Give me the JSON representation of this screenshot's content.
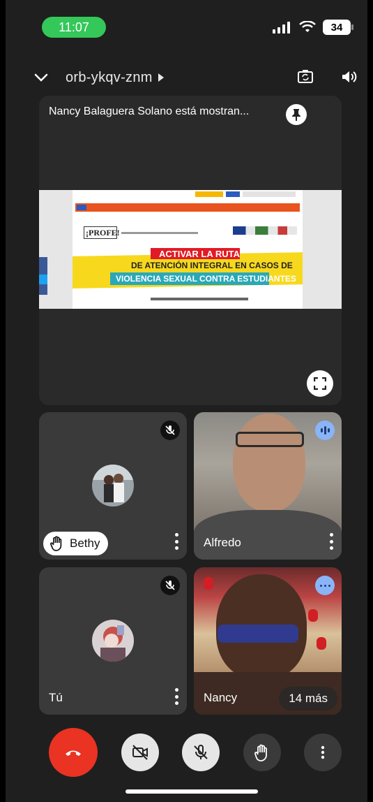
{
  "status_bar": {
    "time": "11:07",
    "battery": "34"
  },
  "meeting": {
    "code": "orb-ykqv-znm"
  },
  "presentation": {
    "title": "Nancy Balaguera Solano está mostran...",
    "shared_page": {
      "badge": "¡PROFE!",
      "banner_line1": "ACTIVAR LA RUTA",
      "banner_line2": "DE ATENCIÓN INTEGRAL EN CASOS DE",
      "banner_line3": "VIOLENCIA SEXUAL CONTRA ESTUDIANTES"
    }
  },
  "participants": [
    {
      "name": "Bethy",
      "state": "muted",
      "hand_raised": true
    },
    {
      "name": "Alfredo",
      "state": "speaking",
      "hand_raised": false
    },
    {
      "name": "Tú",
      "state": "muted",
      "hand_raised": false
    },
    {
      "name": "Nancy",
      "state": "more",
      "hand_raised": false,
      "extra": "14 más"
    }
  ],
  "colors": {
    "end_call": "#ea3323",
    "status_time_pill": "#34c759",
    "speaking_badge": "#8ab4f8"
  }
}
